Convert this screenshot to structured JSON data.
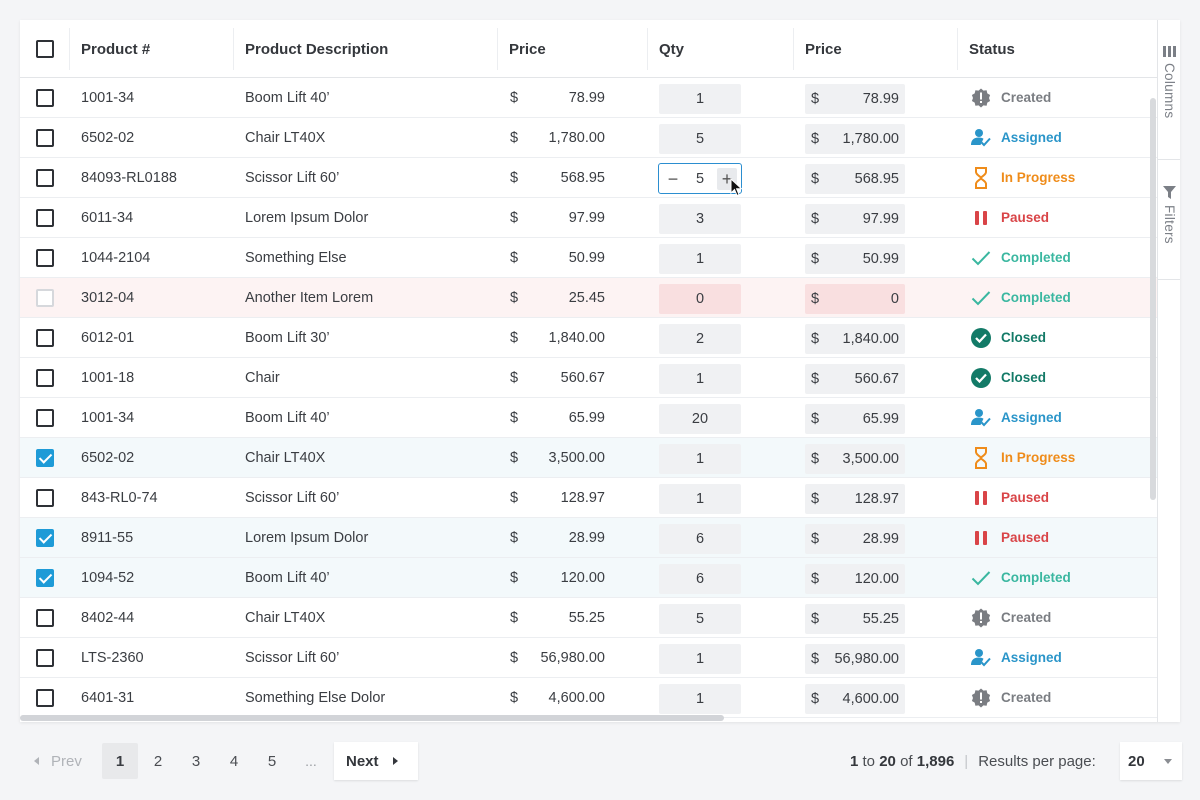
{
  "columns": {
    "product_num": "Product #",
    "description": "Product Description",
    "price": "Price",
    "qty": "Qty",
    "price2": "Price",
    "status": "Status"
  },
  "rows": [
    {
      "product": "1001-34",
      "desc": "Boom Lift 40’",
      "currency": "$",
      "price": "78.99",
      "qty": "1",
      "total": "78.99",
      "status": "Created",
      "status_icon": "alert-badge-icon",
      "selected": false
    },
    {
      "product": "6502-02",
      "desc": "Chair LT40X",
      "currency": "$",
      "price": "1,780.00",
      "qty": "5",
      "total": "1,780.00",
      "status": "Assigned",
      "status_icon": "user-check-icon",
      "selected": false
    },
    {
      "product": "84093-RL0188",
      "desc": "Scissor Lift 60’",
      "currency": "$",
      "price": "568.95",
      "qty": "5",
      "total": "568.95",
      "status": "In Progress",
      "status_icon": "hourglass-icon",
      "selected": false,
      "editing": true
    },
    {
      "product": "6011-34",
      "desc": "Lorem Ipsum Dolor",
      "currency": "$",
      "price": "97.99",
      "qty": "3",
      "total": "97.99",
      "status": "Paused",
      "status_icon": "pause-icon",
      "selected": false
    },
    {
      "product": "1044-2104",
      "desc": "Something Else",
      "currency": "$",
      "price": "50.99",
      "qty": "1",
      "total": "50.99",
      "status": "Completed",
      "status_icon": "check-icon",
      "selected": false
    },
    {
      "product": "3012-04",
      "desc": "Another Item Lorem",
      "currency": "$",
      "price": "25.45",
      "qty": "0",
      "total": "0",
      "status": "Completed",
      "status_icon": "check-icon",
      "selected": false,
      "error": true
    },
    {
      "product": "6012-01",
      "desc": "Boom Lift 30’",
      "currency": "$",
      "price": "1,840.00",
      "qty": "2",
      "total": "1,840.00",
      "status": "Closed",
      "status_icon": "check-circle-icon",
      "selected": false
    },
    {
      "product": "1001-18",
      "desc": "Chair",
      "currency": "$",
      "price": "560.67",
      "qty": "1",
      "total": "560.67",
      "status": "Closed",
      "status_icon": "check-circle-icon",
      "selected": false
    },
    {
      "product": "1001-34",
      "desc": "Boom Lift 40’",
      "currency": "$",
      "price": "65.99",
      "qty": "20",
      "total": "65.99",
      "status": "Assigned",
      "status_icon": "user-check-icon",
      "selected": false
    },
    {
      "product": "6502-02",
      "desc": "Chair LT40X",
      "currency": "$",
      "price": "3,500.00",
      "qty": "1",
      "total": "3,500.00",
      "status": "In Progress",
      "status_icon": "hourglass-icon",
      "selected": true
    },
    {
      "product": "843-RL0-74",
      "desc": "Scissor Lift 60’",
      "currency": "$",
      "price": "128.97",
      "qty": "1",
      "total": "128.97",
      "status": "Paused",
      "status_icon": "pause-icon",
      "selected": false
    },
    {
      "product": "8911-55",
      "desc": "Lorem Ipsum Dolor",
      "currency": "$",
      "price": "28.99",
      "qty": "6",
      "total": "28.99",
      "status": "Paused",
      "status_icon": "pause-icon",
      "selected": true
    },
    {
      "product": "1094-52",
      "desc": "Boom Lift 40’",
      "currency": "$",
      "price": "120.00",
      "qty": "6",
      "total": "120.00",
      "status": "Completed",
      "status_icon": "check-icon",
      "selected": true
    },
    {
      "product": "8402-44",
      "desc": "Chair LT40X",
      "currency": "$",
      "price": "55.25",
      "qty": "5",
      "total": "55.25",
      "status": "Created",
      "status_icon": "alert-badge-icon",
      "selected": false
    },
    {
      "product": "LTS-2360",
      "desc": "Scissor Lift 60’",
      "currency": "$",
      "price": "56,980.00",
      "qty": "1",
      "total": "56,980.00",
      "status": "Assigned",
      "status_icon": "user-check-icon",
      "selected": false
    },
    {
      "product": "6401-31",
      "desc": "Something Else Dolor",
      "currency": "$",
      "price": "4,600.00",
      "qty": "1",
      "total": "4,600.00",
      "status": "Created",
      "status_icon": "alert-badge-icon",
      "selected": false
    }
  ],
  "status_colors": {
    "Created": "#7a7d82",
    "Assigned": "#2a95c9",
    "In Progress": "#ef8c1a",
    "Paused": "#d94447",
    "Completed": "#3ab7a0",
    "Closed": "#137a67"
  },
  "side_panel": {
    "columns_label": "Columns",
    "columns_icon": "columns-icon",
    "filters_label": "Filters",
    "filters_icon": "filter-icon"
  },
  "pagination": {
    "prev_label": "Prev",
    "pages": [
      "1",
      "2",
      "3",
      "4",
      "5"
    ],
    "current_page": "1",
    "ellipsis": "...",
    "next_label": "Next",
    "range_from": "1",
    "range_to_word": "to",
    "range_to": "20",
    "of_word": "of",
    "total": "1,896",
    "separator": "|",
    "results_per_page_label": "Results per page:",
    "results_per_page_value": "20"
  }
}
